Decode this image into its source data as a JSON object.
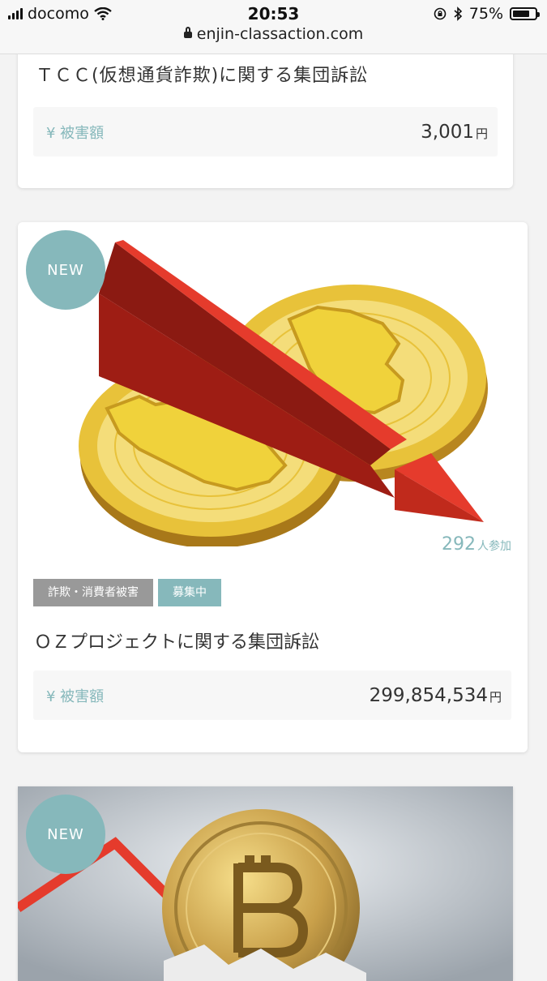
{
  "status_bar": {
    "carrier": "docomo",
    "time": "20:53",
    "battery": "75%",
    "battery_level": 0.75,
    "url": "enjin-classaction.com"
  },
  "cards": [
    {
      "title": "ＴＣＣ(仮想通貨詐欺)に関する集団訴訟",
      "damage_label": "¥ 被害額",
      "damage_amount": "3,001",
      "currency": "円"
    },
    {
      "badge": "NEW",
      "participants": "292",
      "participants_suffix": "人参加",
      "tags": [
        "詐欺・消費者被害",
        "募集中"
      ],
      "title": "ＯＺプロジェクトに関する集団訴訟",
      "damage_label": "¥ 被害額",
      "damage_amount": "299,854,534",
      "currency": "円"
    },
    {
      "badge": "NEW"
    }
  ],
  "colors": {
    "accent": "#86b8bb",
    "tag_grey": "#999999",
    "arrow_red": "#e53b2c",
    "coin_gold": "#e8c23a"
  }
}
